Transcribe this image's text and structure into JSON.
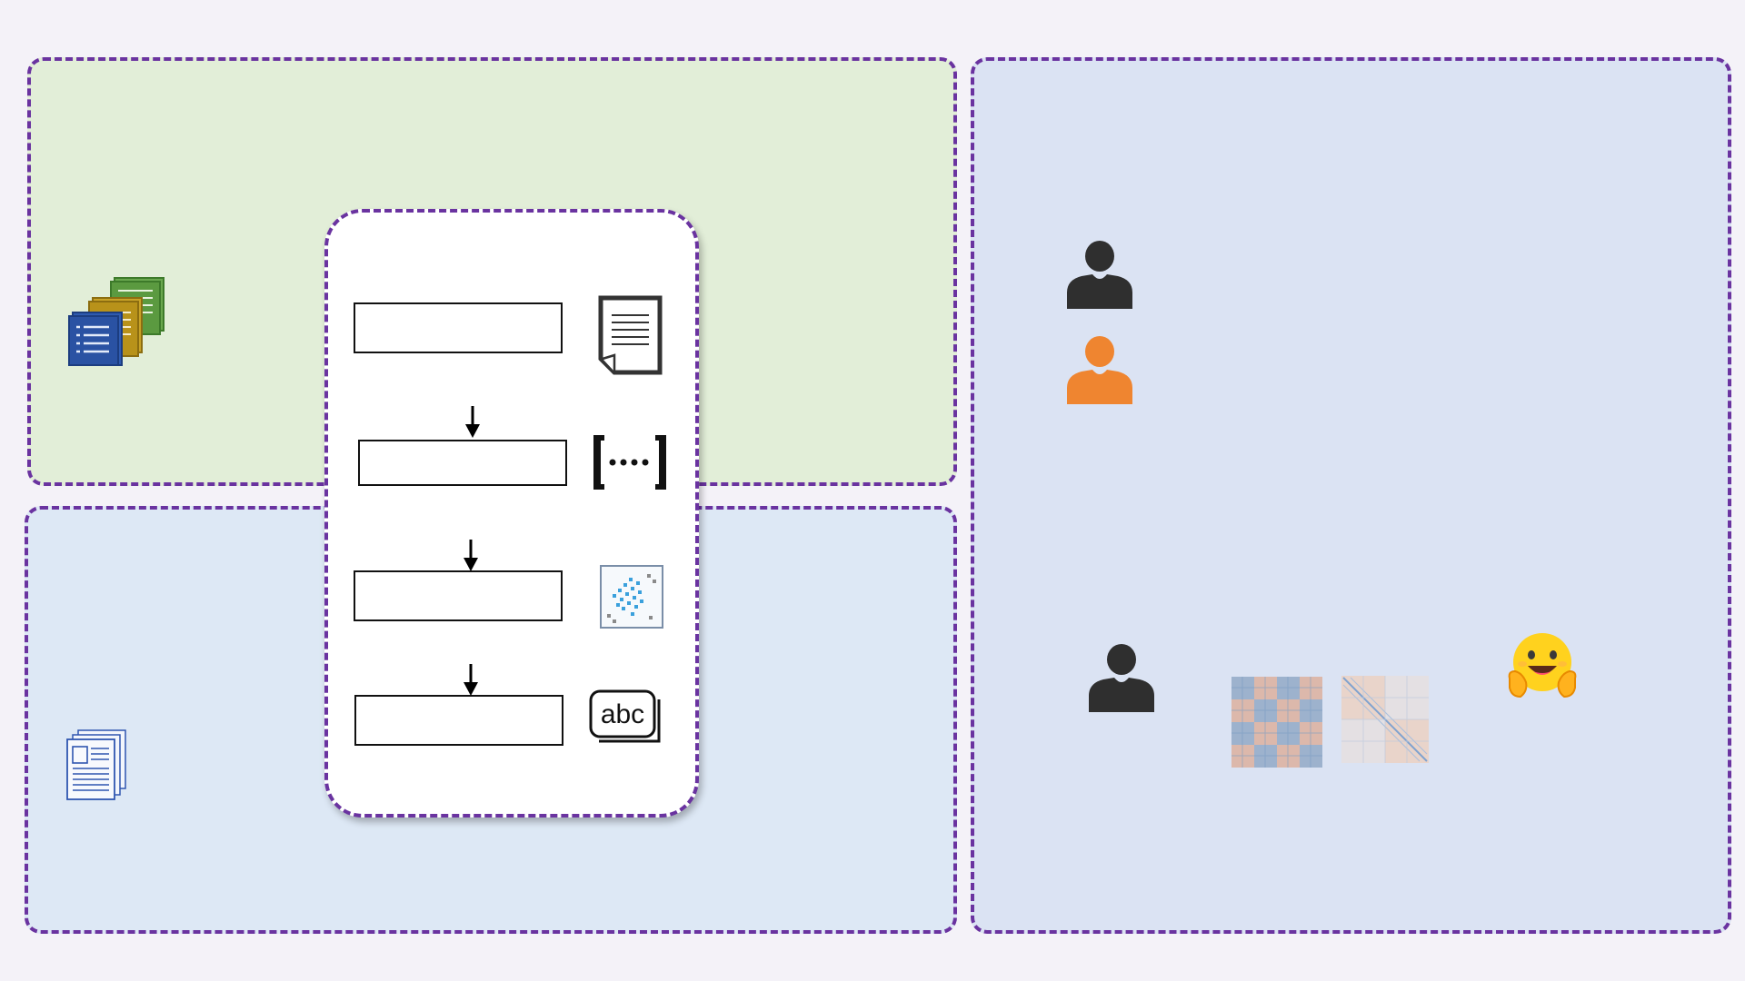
{
  "diagram": {
    "panels": [
      {
        "name": "top-left",
        "fill": "#e2eed8"
      },
      {
        "name": "bottom-left",
        "fill": "#dde8f5"
      },
      {
        "name": "right",
        "fill": "#dbe3f3"
      }
    ],
    "border_color": "#6a33a0",
    "pipeline": {
      "steps": [
        {
          "label": "",
          "icon": "document-icon"
        },
        {
          "label": "",
          "icon": "bracket-list-icon"
        },
        {
          "label": "",
          "icon": "scatter-matrix-icon"
        },
        {
          "label": "",
          "icon": "abc-text-icon"
        }
      ]
    },
    "icons": {
      "top_left": "stacked-color-documents-icon",
      "bottom_left": "news-pages-icon",
      "right": [
        "person-dark-icon",
        "person-orange-icon",
        "person-dark-icon",
        "matrix-heatmap-icon",
        "matrix-heatmap-icon",
        "hugging-face-emoji-icon"
      ]
    },
    "colors": {
      "person_dark": "#2f2f2f",
      "person_orange": "#ef8530",
      "emoji_yellow": "#ffd21e"
    }
  }
}
